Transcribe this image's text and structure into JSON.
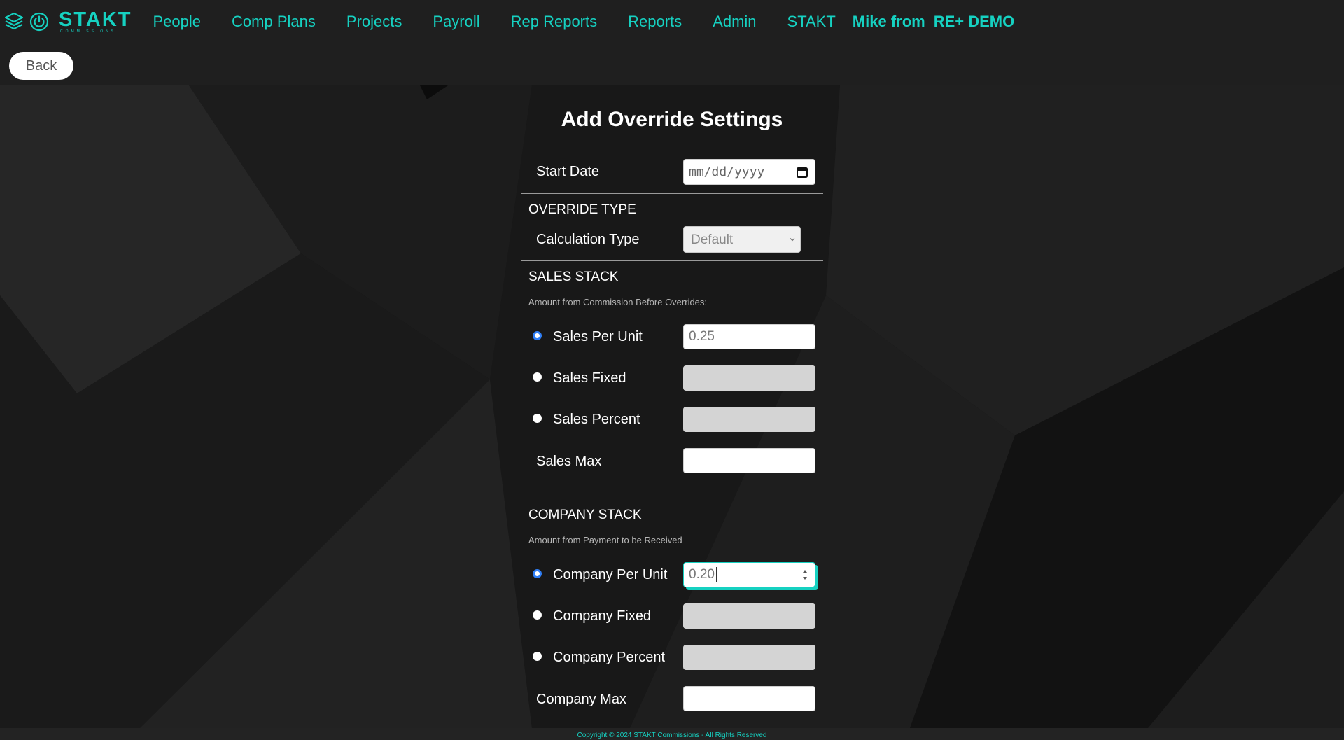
{
  "nav": {
    "brand": "STAKT",
    "brand_sub": "COMMISSIONS",
    "items": [
      "People",
      "Comp Plans",
      "Projects",
      "Payroll",
      "Rep Reports",
      "Reports",
      "Admin",
      "STAKT"
    ],
    "user_prefix": "Mike from",
    "user_org": "RE+ DEMO",
    "accent": "#16d1c1"
  },
  "back_label": "Back",
  "form": {
    "title": "Add Override Settings",
    "start_date": {
      "label": "Start Date",
      "placeholder": "mm/dd/yyyy"
    },
    "override_type": {
      "heading": "OVERRIDE TYPE",
      "calc_label": "Calculation Type",
      "calc_value": "Default"
    },
    "sales_stack": {
      "heading": "SALES STACK",
      "hint": "Amount from Commission Before Overrides:",
      "per_unit_label": "Sales Per Unit",
      "per_unit_value": "0.25",
      "fixed_label": "Sales Fixed",
      "percent_label": "Sales Percent",
      "max_label": "Sales Max"
    },
    "company_stack": {
      "heading": "COMPANY STACK",
      "hint": "Amount from Payment to be Received",
      "per_unit_label": "Company Per Unit",
      "per_unit_value": "0.20",
      "fixed_label": "Company Fixed",
      "percent_label": "Company Percent",
      "max_label": "Company Max"
    }
  },
  "footer": "Copyright © 2024 STAKT Commissions - All Rights Reserved"
}
